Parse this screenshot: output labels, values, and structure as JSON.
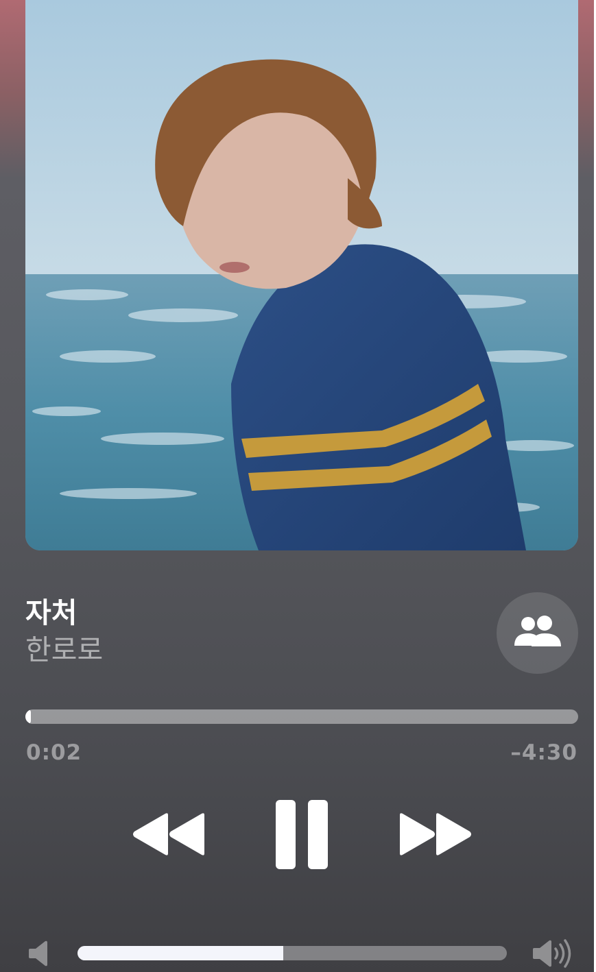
{
  "now_playing": {
    "title": "자처",
    "artist": "한로로"
  },
  "playback": {
    "elapsed": "0:02",
    "remaining": "–4:30",
    "progress_fraction": 0.0074
  },
  "volume": {
    "level_fraction": 0.48
  },
  "icons": {
    "shareplay": "shareplay-people-icon",
    "previous": "rewind-icon",
    "pause": "pause-icon",
    "next": "fast-forward-icon",
    "volume_low": "speaker-low-icon",
    "volume_high": "speaker-high-icon"
  },
  "colors": {
    "accent": "#ffffff",
    "top_tint": "#b06a72",
    "background": "#56575c"
  }
}
